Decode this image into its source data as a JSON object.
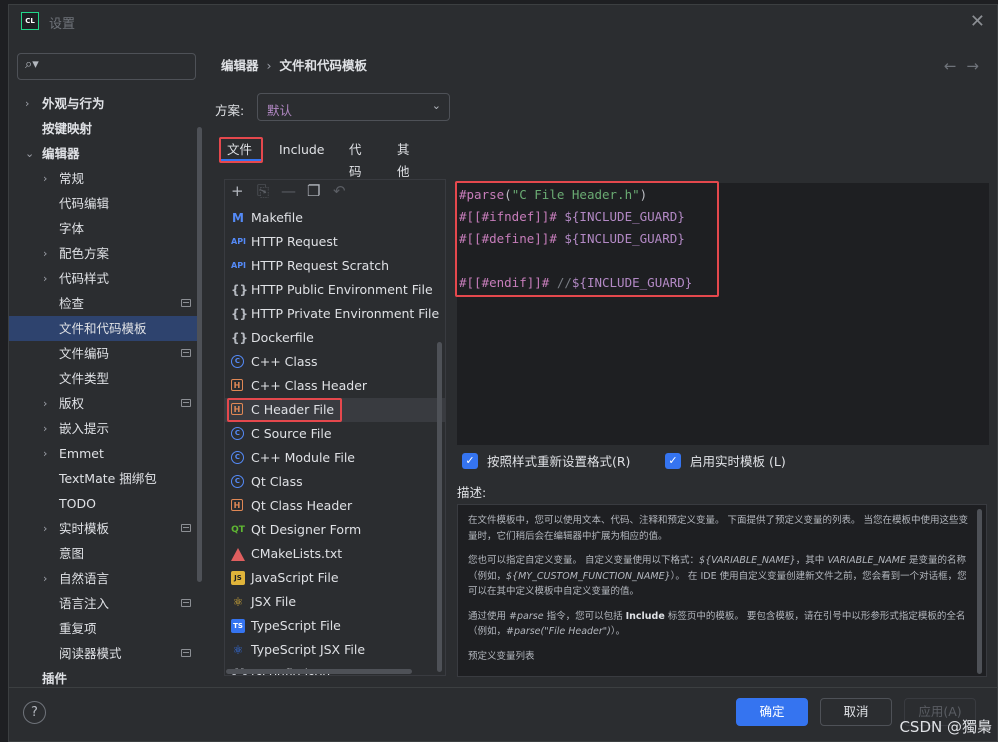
{
  "window": {
    "title": "设置",
    "logo": "CL"
  },
  "search": {
    "icon": "search-icon"
  },
  "sidebar": {
    "items": [
      {
        "label": "外观与行为",
        "arrow": "›",
        "bold": true
      },
      {
        "label": "按键映射",
        "bold": true
      },
      {
        "label": "编辑器",
        "arrow": "⌄",
        "bold": true
      },
      {
        "label": "常规",
        "arrow": "›"
      },
      {
        "label": "代码编辑"
      },
      {
        "label": "字体"
      },
      {
        "label": "配色方案",
        "arrow": "›"
      },
      {
        "label": "代码样式",
        "arrow": "›"
      },
      {
        "label": "检查",
        "page": true
      },
      {
        "label": "文件和代码模板",
        "selected": true
      },
      {
        "label": "文件编码",
        "page": true
      },
      {
        "label": "文件类型"
      },
      {
        "label": "版权",
        "arrow": "›",
        "page": true
      },
      {
        "label": "嵌入提示",
        "arrow": "›"
      },
      {
        "label": "Emmet",
        "arrow": "›"
      },
      {
        "label": "TextMate 捆绑包"
      },
      {
        "label": "TODO"
      },
      {
        "label": "实时模板",
        "arrow": "›",
        "page": true
      },
      {
        "label": "意图"
      },
      {
        "label": "自然语言",
        "arrow": "›"
      },
      {
        "label": "语言注入",
        "page": true
      },
      {
        "label": "重复项"
      },
      {
        "label": "阅读器模式",
        "page": true
      },
      {
        "label": "插件",
        "bold": true
      }
    ]
  },
  "breadcrumb": {
    "part1": "编辑器",
    "separator": "›",
    "part2": "文件和代码模板"
  },
  "nav": {
    "back": "←",
    "forward": "→"
  },
  "scheme": {
    "label": "方案:",
    "value": "默认"
  },
  "tabs": [
    "文件",
    "Include",
    "代码",
    "其他"
  ],
  "toolbar": {
    "add": "+",
    "copy": "⎘",
    "remove": "—",
    "duplicate": "❐",
    "reset": "↶"
  },
  "templates": [
    {
      "label": "Makefile",
      "icon": "mk",
      "glyph": "M"
    },
    {
      "label": "HTTP Request",
      "icon": "api",
      "glyph": "API"
    },
    {
      "label": "HTTP Request Scratch",
      "icon": "api",
      "glyph": "API"
    },
    {
      "label": "HTTP Public Environment File",
      "icon": "br",
      "glyph": "{}"
    },
    {
      "label": "HTTP Private Environment File",
      "icon": "br",
      "glyph": "{}"
    },
    {
      "label": "Dockerfile",
      "icon": "br",
      "glyph": "{}"
    },
    {
      "label": "C++ Class",
      "icon": "cpp",
      "glyph": "C"
    },
    {
      "label": "C++ Class Header",
      "icon": "hh",
      "glyph": "H"
    },
    {
      "label": "C Header File",
      "icon": "hh",
      "glyph": "H",
      "selected": true
    },
    {
      "label": "C Source File",
      "icon": "cpp",
      "glyph": "C"
    },
    {
      "label": "C++ Module File",
      "icon": "cpp",
      "glyph": "C"
    },
    {
      "label": "Qt Class",
      "icon": "cpp",
      "glyph": "C"
    },
    {
      "label": "Qt Class Header",
      "icon": "hh",
      "glyph": "H"
    },
    {
      "label": "Qt Designer Form",
      "icon": "qt",
      "glyph": "QT"
    },
    {
      "label": "CMakeLists.txt",
      "icon": "cm",
      "glyph": ""
    },
    {
      "label": "JavaScript File",
      "icon": "js",
      "glyph": "JS"
    },
    {
      "label": "JSX File",
      "icon": "jsx",
      "glyph": "⚛"
    },
    {
      "label": "TypeScript File",
      "icon": "ts",
      "glyph": "TS"
    },
    {
      "label": "TypeScript JSX File",
      "icon": "tsx",
      "glyph": "⚛"
    },
    {
      "label": "tsconfig.json",
      "icon": "tsc",
      "glyph": "{}"
    }
  ],
  "code": {
    "l1": {
      "directive": "#parse",
      "open": "(",
      "str": "\"C File Header.h\"",
      "close": ")"
    },
    "l2": {
      "a": "#[[",
      "b": "#ifndef",
      "c": "]]#",
      "d": "${INCLUDE_GUARD}"
    },
    "l3": {
      "a": "#[[",
      "b": "#define",
      "c": "]]#",
      "d": "${INCLUDE_GUARD}"
    },
    "l5": {
      "a": "#[[",
      "b": "#endif",
      "c": "]]#",
      "e": "//",
      "d": "${INCLUDE_GUARD}"
    }
  },
  "options": {
    "reformat": "按照样式重新设置格式(R)",
    "live": "启用实时模板 (L)"
  },
  "description": {
    "label": "描述:",
    "p1": "在文件模板中，您可以使用文本、代码、注释和预定义变量。 下面提供了预定义变量的列表。 当您在模板中使用这些变量时，它们稍后会在编辑器中扩展为相应的值。",
    "p2a": "您也可以指定自定义变量。 自定义变量使用以下格式：",
    "p2b": "${VARIABLE_NAME}",
    "p2c": "，其中 ",
    "p2d": "VARIABLE_NAME",
    "p2e": " 是变量的名称（例如，",
    "p2f": "${MY_CUSTOM_FUNCTION_NAME}",
    "p2g": "）。 在 IDE 使用自定义变量创建新文件之前，您会看到一个对话框，您可以在其中定义模板中自定义变量的值。",
    "p3a": "通过使用 ",
    "p3b": "#parse",
    "p3c": " 指令，您可以包括 ",
    "p3d": "Include",
    "p3e": " 标签页中的模板。 要包含模板，请在引号中以形参形式指定模板的全名（例如，",
    "p3f": "#parse(\"File Header\")",
    "p3g": "）。",
    "p4": "预定义变量列表"
  },
  "buttons": {
    "help": "?",
    "ok": "确定",
    "cancel": "取消",
    "apply": "应用(A)"
  },
  "watermark": "CSDN @獨梟"
}
